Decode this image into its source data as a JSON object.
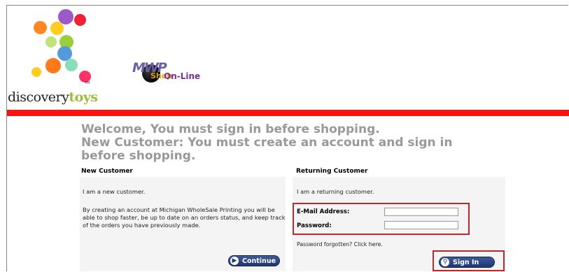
{
  "brand": {
    "wordmark_part1": "discovery",
    "wordmark_part2": "toys",
    "tm": "TM",
    "colors": {
      "purple": "#9b59c9",
      "orange": "#ff7a1a",
      "red": "#ee2233",
      "yellow": "#ffcc22",
      "green": "#9bcf3a",
      "blue": "#5599dd",
      "mint": "#88ddbb",
      "pink": "#ff3366",
      "lime": "#9cbf3a",
      "accent_bar": "#ff1111"
    }
  },
  "mwp_logo": {
    "letters": "MWP",
    "shop": "Shop",
    "online": "On-Line"
  },
  "headline": {
    "line1": "Welcome, You must sign in before shopping.",
    "line2": "New Customer: You must create an account and sign in before shopping."
  },
  "new_customer": {
    "title": "New Customer",
    "intro": "I am a new customer.",
    "description": "By creating an account at Michigan WholeSale Printing you will be able to shop faster, be up to date on an orders status, and keep track of the orders you have previously made.",
    "button_label": "Continue",
    "button_icon": "arrow-right-icon"
  },
  "returning_customer": {
    "title": "Returning Customer",
    "intro": "I am a returning customer.",
    "email_label": "E-Mail Address:",
    "email_value": "",
    "password_label": "Password:",
    "password_value": "",
    "forgot_text": "Password forgotten? Click here.",
    "button_label": "Sign In",
    "button_icon": "key-icon"
  }
}
